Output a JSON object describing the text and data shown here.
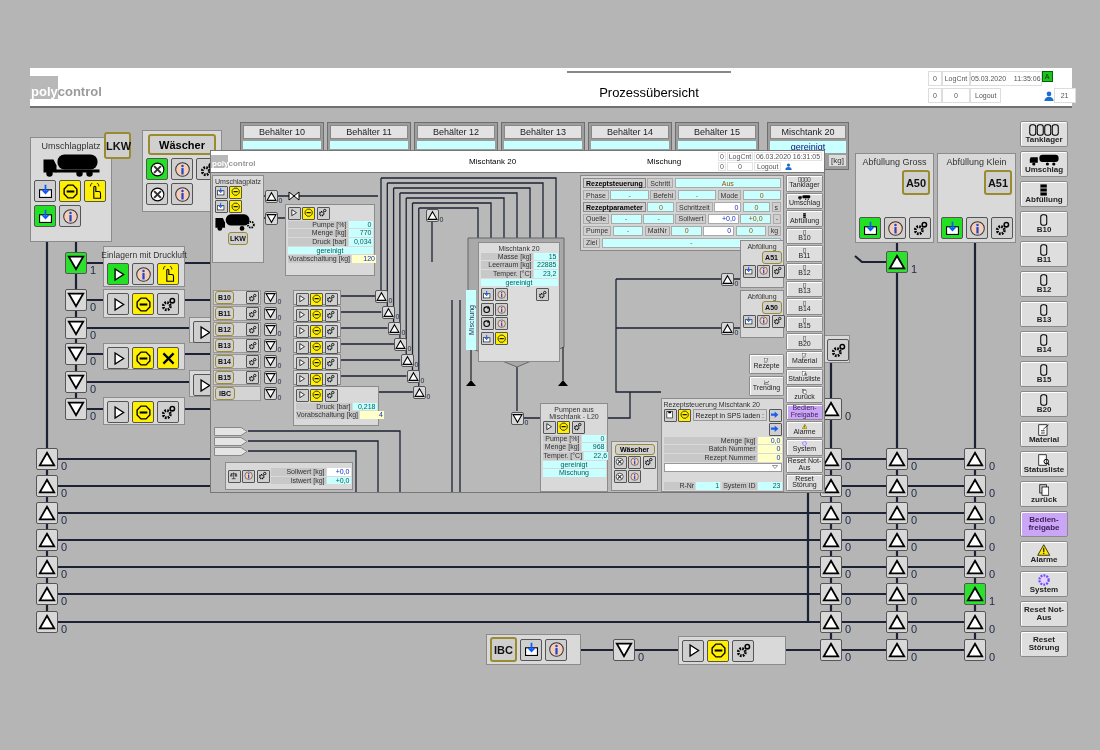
{
  "header": {
    "logo_part_1": "poly",
    "logo_part_2": "control",
    "title": "Prozessübersicht",
    "alarm_count": "0",
    "log_label": "LogCnt",
    "date": "05.03.2020",
    "time": "11:35:06",
    "counter_a": "0",
    "counter_b": "0",
    "logout": "Logout",
    "user_count": "21",
    "mode_badge": "A"
  },
  "tanks": [
    {
      "label": "Behälter 10"
    },
    {
      "label": "Behälter 11"
    },
    {
      "label": "Behälter 12"
    },
    {
      "label": "Behälter 13"
    },
    {
      "label": "Behälter 14"
    },
    {
      "label": "Behälter 15"
    },
    {
      "label": "Mischtank 20",
      "status": "gereinigt",
      "unit": "[kg]"
    }
  ],
  "loading_station": {
    "title": "Umschlagplatz",
    "button": "LKW",
    "icons": [
      {
        "kind": "fill",
        "on": false,
        "alert": false
      },
      {
        "kind": "stop",
        "on": false,
        "alert": true
      },
      {
        "kind": "hand",
        "on": false,
        "alert": true
      },
      {
        "kind": "fill",
        "on": true,
        "alert": false
      },
      {
        "kind": "info",
        "on": false,
        "alert": false
      }
    ]
  },
  "washer": {
    "button": "Wäscher",
    "icons": [
      {
        "kind": "fan",
        "on": true,
        "alert": false
      },
      {
        "kind": "info",
        "on": false,
        "alert": false
      },
      {
        "kind": "gear",
        "on": false,
        "alert": false
      },
      {
        "kind": "fan",
        "on": false,
        "alert": false
      },
      {
        "kind": "info",
        "on": false,
        "alert": false
      }
    ]
  },
  "intake_rows": [
    {
      "title": "Einlagern mit Druckluft",
      "icons": [
        {
          "kind": "play",
          "on": true,
          "alert": false
        },
        {
          "kind": "info",
          "on": false,
          "alert": false
        },
        {
          "kind": "hand",
          "on": false,
          "alert": true
        }
      ]
    },
    {
      "icons": [
        {
          "kind": "play",
          "on": false,
          "alert": false
        },
        {
          "kind": "stop",
          "on": false,
          "alert": true
        },
        {
          "kind": "gear",
          "on": false,
          "alert": false
        }
      ]
    },
    {
      "icons": [
        {
          "kind": "play",
          "on": false,
          "alert": false
        }
      ]
    },
    {
      "icons": [
        {
          "kind": "play",
          "on": false,
          "alert": false
        },
        {
          "kind": "stop",
          "on": false,
          "alert": true
        },
        {
          "kind": "wrench",
          "on": false,
          "alert": true
        }
      ]
    },
    {
      "icons": [
        {
          "kind": "play",
          "on": false,
          "alert": false
        }
      ]
    },
    {
      "icons": [
        {
          "kind": "play",
          "on": false,
          "alert": false
        },
        {
          "kind": "stop",
          "on": false,
          "alert": true
        },
        {
          "kind": "gear",
          "on": false,
          "alert": false
        }
      ]
    }
  ],
  "filling": [
    {
      "title": "Abfüllung Gross",
      "button": "A50",
      "icons": [
        {
          "kind": "fill",
          "on": true,
          "alert": false
        },
        {
          "kind": "info",
          "on": false,
          "alert": false
        },
        {
          "kind": "gear",
          "on": false,
          "alert": false
        }
      ]
    },
    {
      "title": "Abfüllung Klein",
      "button": "A51",
      "icons": [
        {
          "kind": "fill",
          "on": true,
          "alert": false
        },
        {
          "kind": "info",
          "on": false,
          "alert": false
        },
        {
          "kind": "gear",
          "on": false,
          "alert": false
        }
      ]
    }
  ],
  "mixer_gear": {
    "kind": "gear",
    "on": false,
    "alert": false
  },
  "ibc": {
    "button": "IBC",
    "icons": [
      {
        "kind": "fill",
        "on": false,
        "alert": false
      },
      {
        "kind": "info",
        "on": false,
        "alert": false
      }
    ]
  },
  "outlet_pump": {
    "icons": [
      {
        "kind": "play",
        "on": false,
        "alert": false
      },
      {
        "kind": "stop",
        "on": false,
        "alert": true
      },
      {
        "kind": "gear",
        "on": false,
        "alert": false
      }
    ]
  },
  "valves": [
    {
      "kind": "down",
      "open": true,
      "value": "1"
    },
    {
      "kind": "down",
      "open": false,
      "value": "0"
    },
    {
      "kind": "down",
      "open": false,
      "value": "0"
    },
    {
      "kind": "down",
      "open": false,
      "value": "0"
    },
    {
      "kind": "down",
      "open": false,
      "value": "0"
    },
    {
      "kind": "down",
      "open": false,
      "value": "0"
    },
    {
      "kind": "up",
      "open": false,
      "value": "0"
    },
    {
      "kind": "up",
      "open": false,
      "value": "0"
    },
    {
      "kind": "up",
      "open": false,
      "value": "0"
    },
    {
      "kind": "up",
      "open": false,
      "value": "0"
    },
    {
      "kind": "up",
      "open": false,
      "value": "0"
    },
    {
      "kind": "up",
      "open": false,
      "value": "0"
    },
    {
      "kind": "up",
      "open": false,
      "value": "0"
    },
    {
      "kind": "down",
      "open": false,
      "value": "0"
    },
    {
      "kind": "up",
      "open": false,
      "value": "0"
    },
    {
      "kind": "up",
      "open": false,
      "value": "0"
    },
    {
      "kind": "up",
      "open": false,
      "value": "0"
    },
    {
      "kind": "up",
      "open": false,
      "value": "0"
    },
    {
      "kind": "up",
      "open": false,
      "value": "0"
    },
    {
      "kind": "up",
      "open": false,
      "value": "0"
    },
    {
      "kind": "up",
      "open": false,
      "value": "0"
    },
    {
      "kind": "up",
      "open": false,
      "value": "0"
    },
    {
      "kind": "up",
      "open": false,
      "value": "0"
    },
    {
      "kind": "up",
      "open": true,
      "value": "1"
    },
    {
      "kind": "up",
      "open": false,
      "value": "0"
    },
    {
      "kind": "up",
      "open": false,
      "value": "0"
    },
    {
      "kind": "up",
      "open": false,
      "value": "0"
    },
    {
      "kind": "up",
      "open": false,
      "value": "0"
    },
    {
      "kind": "up",
      "open": false,
      "value": "0"
    },
    {
      "kind": "up",
      "open": false,
      "value": "0"
    },
    {
      "kind": "up",
      "open": false,
      "value": "0"
    },
    {
      "kind": "up",
      "open": false,
      "value": "0"
    },
    {
      "kind": "up",
      "open": false,
      "value": "0"
    },
    {
      "kind": "up",
      "open": false,
      "value": "0"
    },
    {
      "kind": "up",
      "open": false,
      "value": "0"
    },
    {
      "kind": "up",
      "open": false,
      "value": "0"
    },
    {
      "kind": "up",
      "open": false,
      "value": "0"
    },
    {
      "kind": "up",
      "open": true,
      "value": "1"
    },
    {
      "kind": "up",
      "open": false,
      "value": "0"
    },
    {
      "kind": "up",
      "open": false,
      "value": "0"
    }
  ],
  "sidebar": [
    {
      "label": "Tanklager",
      "kind": "tanks",
      "selected": false
    },
    {
      "label": "Umschlag",
      "kind": "truck",
      "selected": false
    },
    {
      "label": "Abfüllung",
      "kind": "barrel",
      "selected": false
    },
    {
      "label": "B10",
      "kind": "tank",
      "selected": false
    },
    {
      "label": "B11",
      "kind": "tank",
      "selected": false
    },
    {
      "label": "B12",
      "kind": "tank",
      "selected": false
    },
    {
      "label": "B13",
      "kind": "tank",
      "selected": false
    },
    {
      "label": "B14",
      "kind": "tank",
      "selected": false
    },
    {
      "label": "B15",
      "kind": "tank",
      "selected": false
    },
    {
      "label": "B20",
      "kind": "tank",
      "selected": false
    },
    {
      "label": "Material",
      "kind": "material",
      "selected": false
    },
    {
      "label": "Statusliste",
      "kind": "status",
      "selected": false
    },
    {
      "label": "zurück",
      "kind": "back",
      "selected": false
    },
    {
      "label": "Bedien-freigabe",
      "kind": "text",
      "selected": true
    },
    {
      "label": "Alarme",
      "kind": "alarm",
      "selected": false
    },
    {
      "label": "System",
      "kind": "system",
      "selected": false
    },
    {
      "label": "Reset Not-Aus",
      "kind": "text",
      "selected": false
    },
    {
      "label": "Reset Störung",
      "kind": "text",
      "selected": false
    }
  ],
  "popup": {
    "logo_part_1": "poly",
    "logo_part_2": "control",
    "title": "Mischtank 20",
    "subtitle": "Mischung",
    "alarm_count": "0",
    "log_label": "LogCnt",
    "date": "06.03.2020",
    "time": "16:31:05",
    "counter_a": "0",
    "counter_b": "0",
    "logout": "Logout",
    "loading": {
      "title": "Umschlagplatz",
      "button": "LKW",
      "icons": [
        {
          "kind": "fill",
          "on": false,
          "alert": false
        },
        {
          "kind": "stop",
          "on": false,
          "alert": true
        },
        {
          "kind": "fill",
          "on": false,
          "alert": false
        },
        {
          "kind": "stop",
          "on": false,
          "alert": true
        }
      ]
    },
    "pump": {
      "icons": [
        {
          "kind": "play",
          "on": false,
          "alert": false
        },
        {
          "kind": "stop",
          "on": false,
          "alert": true
        },
        {
          "kind": "gear",
          "on": false,
          "alert": false
        }
      ],
      "rows": [
        {
          "kind": "value",
          "label": "Pumpe [%]",
          "value": "0"
        },
        {
          "kind": "value",
          "label": "Menge [kg]",
          "value": "770"
        },
        {
          "kind": "value",
          "label": "Druck [bar]",
          "value": "0,034"
        },
        {
          "kind": "status",
          "value": "gereinigt"
        },
        {
          "kind": "setpoint",
          "label": "Vorabschaltung [kg]",
          "value": "120"
        }
      ]
    },
    "recipe_table": [
      [
        {
          "kind": "header",
          "text": "Rezeptsteuerung"
        },
        {
          "kind": "label",
          "text": "Schritt"
        },
        {
          "kind": "value",
          "text": "Aus"
        }
      ],
      [
        {
          "kind": "label",
          "text": "Phase"
        },
        {
          "kind": "value",
          "text": "-"
        },
        {
          "kind": "label",
          "text": "Befehl"
        },
        {
          "kind": "value",
          "text": "-"
        },
        {
          "kind": "label",
          "text": "Mode"
        },
        {
          "kind": "value",
          "text": "0"
        }
      ],
      [
        {
          "kind": "header",
          "text": "Rezeptparameter"
        },
        {
          "kind": "value",
          "text": "0"
        },
        {
          "kind": "label",
          "text": "Schrittzeit"
        },
        {
          "kind": "input",
          "text": "0"
        },
        {
          "kind": "value",
          "text": "0"
        },
        {
          "kind": "label",
          "text": "s"
        }
      ],
      [
        {
          "kind": "label",
          "text": "Quelle"
        },
        {
          "kind": "value",
          "text": "-"
        },
        {
          "kind": "value",
          "text": "-"
        },
        {
          "kind": "label",
          "text": "Sollwert"
        },
        {
          "kind": "input",
          "text": "+0,0"
        },
        {
          "kind": "value",
          "text": "+0,0"
        },
        {
          "kind": "label",
          "text": "-"
        }
      ],
      [
        {
          "kind": "label",
          "text": "Pumpe"
        },
        {
          "kind": "value",
          "text": "-"
        },
        {
          "kind": "label",
          "text": "MatNr"
        },
        {
          "kind": "value",
          "text": "0"
        },
        {
          "kind": "input",
          "text": "0"
        },
        {
          "kind": "value",
          "text": "0"
        },
        {
          "kind": "label",
          "text": "kg"
        }
      ],
      [
        {
          "kind": "label",
          "text": "Ziel"
        },
        {
          "kind": "value",
          "text": "-"
        }
      ]
    ],
    "tank": {
      "title": "Mischtank 20",
      "rows": [
        {
          "kind": "value",
          "label": "Masse [kg]",
          "value": "15"
        },
        {
          "kind": "value",
          "label": "Leerraum [kg]",
          "value": "22885"
        },
        {
          "kind": "value",
          "label": "Temper. [°C]",
          "value": "23,2"
        },
        {
          "kind": "status",
          "value": "gereinigt"
        }
      ],
      "strip_label": "Mischung",
      "gear": {
        "kind": "gear",
        "on": false,
        "alert": false
      },
      "icons": [
        {
          "kind": "fill",
          "on": false,
          "alert": false
        },
        {
          "kind": "info",
          "on": false,
          "alert": false
        },
        {
          "kind": "cycle",
          "on": false,
          "alert": false
        },
        {
          "kind": "info",
          "on": false,
          "alert": false
        },
        {
          "kind": "cycle",
          "on": false,
          "alert": false
        },
        {
          "kind": "info",
          "on": false,
          "alert": false
        },
        {
          "kind": "fill",
          "on": false,
          "alert": false
        },
        {
          "kind": "stop",
          "on": false,
          "alert": true
        }
      ]
    },
    "tank_rows": [
      {
        "label": "B10",
        "tank_icons": [
          {
            "kind": "gear",
            "on": false,
            "alert": false
          }
        ],
        "pump_icons": [
          {
            "kind": "play",
            "on": false,
            "alert": false
          },
          {
            "kind": "stop",
            "on": false,
            "alert": true
          },
          {
            "kind": "gear",
            "on": false,
            "alert": false
          }
        ]
      },
      {
        "label": "B11",
        "tank_icons": [
          {
            "kind": "gear",
            "on": false,
            "alert": false
          }
        ],
        "pump_icons": [
          {
            "kind": "play",
            "on": false,
            "alert": false
          },
          {
            "kind": "stop",
            "on": false,
            "alert": true
          },
          {
            "kind": "gear",
            "on": false,
            "alert": false
          }
        ]
      },
      {
        "label": "B12",
        "tank_icons": [
          {
            "kind": "gear",
            "on": false,
            "alert": false
          }
        ],
        "pump_icons": [
          {
            "kind": "play",
            "on": false,
            "alert": false
          },
          {
            "kind": "stop",
            "on": false,
            "alert": true
          },
          {
            "kind": "gear",
            "on": false,
            "alert": false
          }
        ]
      },
      {
        "label": "B13",
        "tank_icons": [
          {
            "kind": "gear",
            "on": false,
            "alert": false
          }
        ],
        "pump_icons": [
          {
            "kind": "play",
            "on": false,
            "alert": false
          },
          {
            "kind": "stop",
            "on": false,
            "alert": true
          },
          {
            "kind": "gear",
            "on": false,
            "alert": false
          }
        ]
      },
      {
        "label": "B14",
        "tank_icons": [
          {
            "kind": "gear",
            "on": false,
            "alert": false
          }
        ],
        "pump_icons": [
          {
            "kind": "play",
            "on": false,
            "alert": false
          },
          {
            "kind": "stop",
            "on": false,
            "alert": true
          },
          {
            "kind": "gear",
            "on": false,
            "alert": false
          }
        ]
      },
      {
        "label": "B15",
        "tank_icons": [
          {
            "kind": "gear",
            "on": false,
            "alert": false
          }
        ],
        "pump_icons": [
          {
            "kind": "play",
            "on": false,
            "alert": false
          },
          {
            "kind": "stop",
            "on": false,
            "alert": true
          },
          {
            "kind": "gear",
            "on": false,
            "alert": false
          }
        ]
      },
      {
        "label": "IBC",
        "tank_icons": [],
        "pump_icons": [
          {
            "kind": "play",
            "on": false,
            "alert": false
          },
          {
            "kind": "stop",
            "on": false,
            "alert": true
          },
          {
            "kind": "gear",
            "on": false,
            "alert": false
          }
        ]
      }
    ],
    "pressure_rows": [
      {
        "kind": "value",
        "label": "Druck [bar]",
        "value": "0,218"
      },
      {
        "kind": "setpoint",
        "label": "Vorabschaltung [kg]",
        "value": "4"
      }
    ],
    "scale": {
      "icons": [
        {
          "kind": "scale",
          "on": false,
          "alert": false
        },
        {
          "kind": "info",
          "on": false,
          "alert": false
        },
        {
          "kind": "gear",
          "on": false,
          "alert": false
        }
      ],
      "rows": [
        {
          "kind": "input",
          "label": "Sollwert [kg]",
          "value": "+0,0"
        },
        {
          "kind": "value",
          "label": "Istwert [kg]",
          "value": "+0,0"
        }
      ]
    },
    "pump_out": {
      "title": "Pumpen aus Mischtank - L20",
      "icons": [
        {
          "kind": "play",
          "on": false,
          "alert": false
        },
        {
          "kind": "stop",
          "on": false,
          "alert": true
        },
        {
          "kind": "gear",
          "on": false,
          "alert": false
        }
      ],
      "rows": [
        {
          "kind": "value",
          "label": "Pumpe [%]",
          "value": "0"
        },
        {
          "kind": "value",
          "label": "Menge [kg]",
          "value": "968"
        },
        {
          "kind": "value",
          "label": "Temper. [°C]",
          "value": "22,6"
        },
        {
          "kind": "status",
          "value": "gereinigt"
        },
        {
          "kind": "status",
          "value": "Mischung"
        }
      ]
    },
    "washer": {
      "button": "Wäscher",
      "icons": [
        {
          "kind": "fan",
          "on": false,
          "alert": false
        },
        {
          "kind": "info",
          "on": false,
          "alert": false
        },
        {
          "kind": "gear",
          "on": false,
          "alert": false
        },
        {
          "kind": "fan",
          "on": false,
          "alert": false
        },
        {
          "kind": "info",
          "on": false,
          "alert": false
        }
      ]
    },
    "recipe": {
      "title": "Rezeptsteuerung Mischtank 20",
      "icons": [
        {
          "kind": "disk",
          "on": false,
          "alert": false
        },
        {
          "kind": "stop",
          "on": false,
          "alert": true
        }
      ],
      "load_label": "Rezept in SPS laden :",
      "arrows": [
        {
          "kind": "arrow",
          "on": false,
          "alert": false
        },
        {
          "kind": "arrow",
          "on": false,
          "alert": false
        }
      ],
      "rows": [
        {
          "kind": "setpoint",
          "label": "Menge [kg]",
          "value": "0,0"
        },
        {
          "kind": "setpoint",
          "label": "Batch Nummer",
          "value": "0"
        },
        {
          "kind": "setpoint",
          "label": "Rezept Nummer",
          "value": "0"
        }
      ],
      "footer": [
        {
          "kind": "value",
          "label": "R-Nr",
          "value": "1"
        },
        {
          "kind": "value",
          "label": "System ID",
          "value": "23"
        }
      ]
    },
    "filling": [
      {
        "title": "Abfüllung",
        "button": "A51",
        "icons": [
          {
            "kind": "fill",
            "on": false,
            "alert": false
          },
          {
            "kind": "info",
            "on": false,
            "alert": false
          },
          {
            "kind": "gear",
            "on": false,
            "alert": false
          }
        ]
      },
      {
        "title": "Abfüllung",
        "button": "A50",
        "icons": [
          {
            "kind": "fill",
            "on": false,
            "alert": false
          },
          {
            "kind": "info",
            "on": false,
            "alert": false
          },
          {
            "kind": "gear",
            "on": false,
            "alert": false
          }
        ]
      }
    ],
    "valves": [
      {
        "kind": "up",
        "open": false,
        "value": "0"
      },
      {
        "kind": "down",
        "open": false
      },
      {
        "kind": "up",
        "open": false,
        "value": "0"
      },
      {
        "kind": "down",
        "open": false,
        "value": "0"
      },
      {
        "kind": "down",
        "open": false,
        "value": "0"
      },
      {
        "kind": "down",
        "open": false,
        "value": "0"
      },
      {
        "kind": "down",
        "open": false,
        "value": "0"
      },
      {
        "kind": "down",
        "open": false,
        "value": "0"
      },
      {
        "kind": "down",
        "open": false,
        "value": "0"
      },
      {
        "kind": "down",
        "open": false,
        "value": "0"
      },
      {
        "kind": "up",
        "open": false,
        "value": "0"
      },
      {
        "kind": "up",
        "open": false,
        "value": "0"
      },
      {
        "kind": "up",
        "open": false,
        "value": "0"
      },
      {
        "kind": "up",
        "open": false,
        "value": "0"
      },
      {
        "kind": "up",
        "open": false,
        "value": "0"
      },
      {
        "kind": "up",
        "open": false,
        "value": "0"
      },
      {
        "kind": "up",
        "open": false,
        "value": "0"
      },
      {
        "kind": "down",
        "open": false,
        "value": "0"
      },
      {
        "kind": "up",
        "open": false,
        "value": "0"
      },
      {
        "kind": "up",
        "open": false,
        "value": "0"
      }
    ],
    "side_extra": [
      {
        "label": "Rezepte",
        "kind": "material"
      },
      {
        "label": "Trending",
        "kind": "trend"
      }
    ],
    "sidebar": [
      {
        "label": "Tanklager",
        "kind": "tanks",
        "selected": false
      },
      {
        "label": "Umschlag",
        "kind": "truck",
        "selected": false
      },
      {
        "label": "Abfüllung",
        "kind": "barrel",
        "selected": false
      },
      {
        "label": "B10",
        "kind": "tank",
        "selected": false
      },
      {
        "label": "B11",
        "kind": "tank",
        "selected": false
      },
      {
        "label": "B12",
        "kind": "tank",
        "selected": false
      },
      {
        "label": "B13",
        "kind": "tank",
        "selected": false
      },
      {
        "label": "B14",
        "kind": "tank",
        "selected": false
      },
      {
        "label": "B15",
        "kind": "tank",
        "selected": false
      },
      {
        "label": "B20",
        "kind": "tank",
        "selected": false
      },
      {
        "label": "Material",
        "kind": "material",
        "selected": false
      },
      {
        "label": "Statusliste",
        "kind": "status",
        "selected": false
      },
      {
        "label": "zurück",
        "kind": "back",
        "selected": false
      },
      {
        "label": "Bedien-Freigabe",
        "kind": "text",
        "selected": true
      },
      {
        "label": "Alarme",
        "kind": "alarm",
        "selected": false
      },
      {
        "label": "System",
        "kind": "system",
        "selected": false
      },
      {
        "label": "Reset Not-Aus",
        "kind": "text",
        "selected": false
      },
      {
        "label": "Reset Störung",
        "kind": "text",
        "selected": false
      }
    ]
  }
}
